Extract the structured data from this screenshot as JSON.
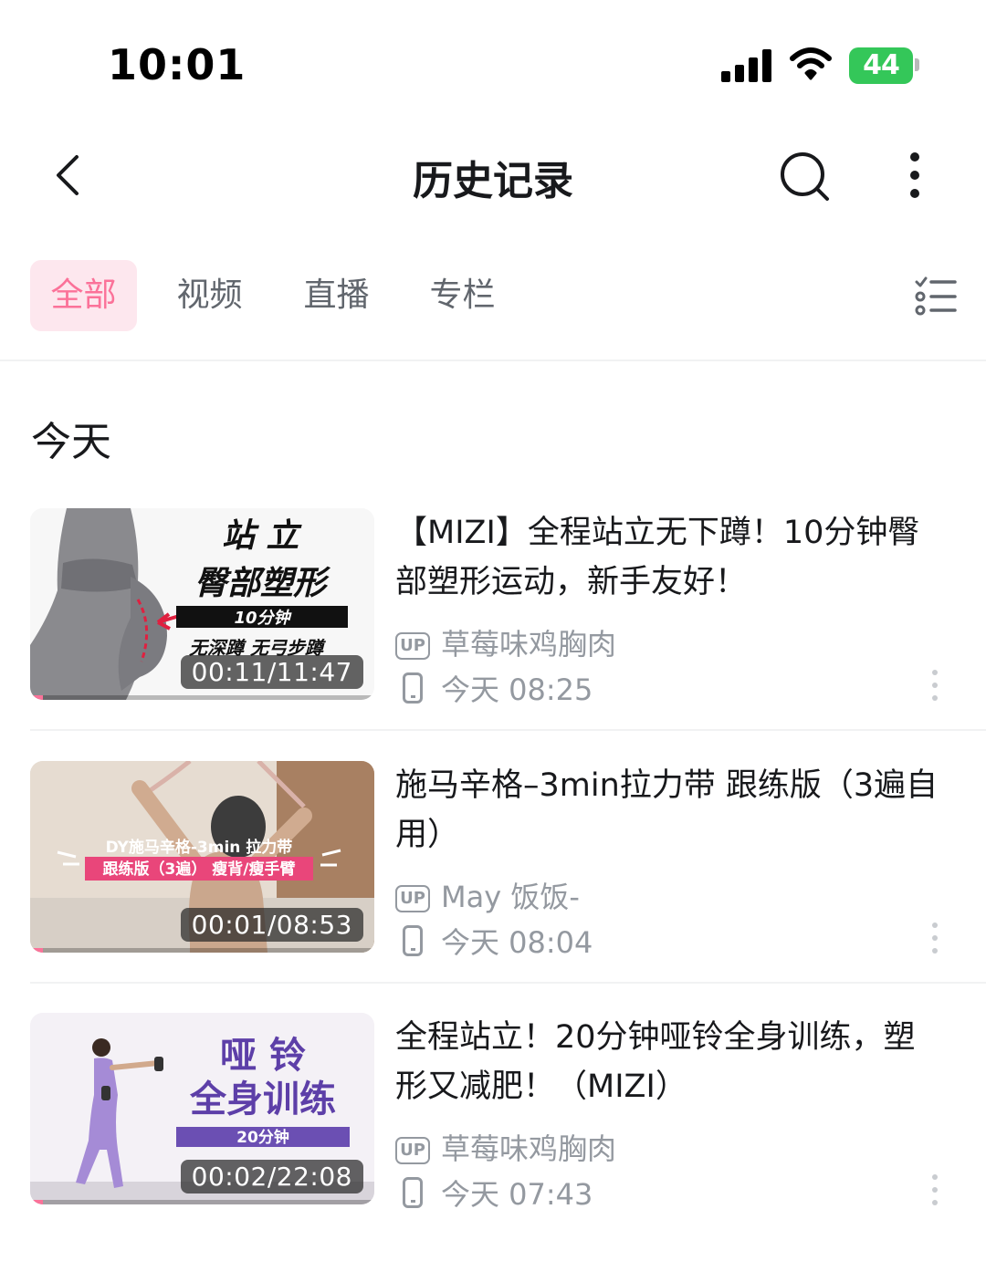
{
  "status_bar": {
    "time": "10:01",
    "battery": "44"
  },
  "nav": {
    "title": "历史记录"
  },
  "tabs": [
    {
      "label": "全部",
      "active": true
    },
    {
      "label": "视频",
      "active": false
    },
    {
      "label": "直播",
      "active": false
    },
    {
      "label": "专栏",
      "active": false
    }
  ],
  "section": {
    "title": "今天"
  },
  "items": [
    {
      "title": "【MIZI】全程站立无下蹲！10分钟臀部塑形运动，新手友好！",
      "uploader": "草莓味鸡胸肉",
      "time": "今天 08:25",
      "duration": "00:11/11:47",
      "progress": 0.016,
      "thumb_texts": [
        "站 立",
        "臀部塑形",
        "10分钟",
        "无深蹲 无弓步蹲"
      ]
    },
    {
      "title": "施马辛格–3min拉力带 跟练版（3遍自用）",
      "uploader": "May 饭饭-",
      "time": "今天 08:04",
      "duration": "00:01/08:53",
      "progress": 0.002,
      "thumb_texts": [
        "DY施马辛格-3min 拉力带",
        "跟练版（3遍） 瘦背/瘦手臂"
      ]
    },
    {
      "title": "全程站立！20分钟哑铃全身训练，塑形又减肥！（MIZI）",
      "uploader": "草莓味鸡胸肉",
      "time": "今天 07:43",
      "duration": "00:02/22:08",
      "progress": 0.002,
      "thumb_texts": [
        "哑 铃",
        "全身训练",
        "20分钟"
      ]
    }
  ],
  "labels": {
    "up_badge": "UP"
  },
  "colors": {
    "accent": "#fb7299",
    "accent_bg": "#fde7ee",
    "text_secondary": "#9499a0"
  }
}
